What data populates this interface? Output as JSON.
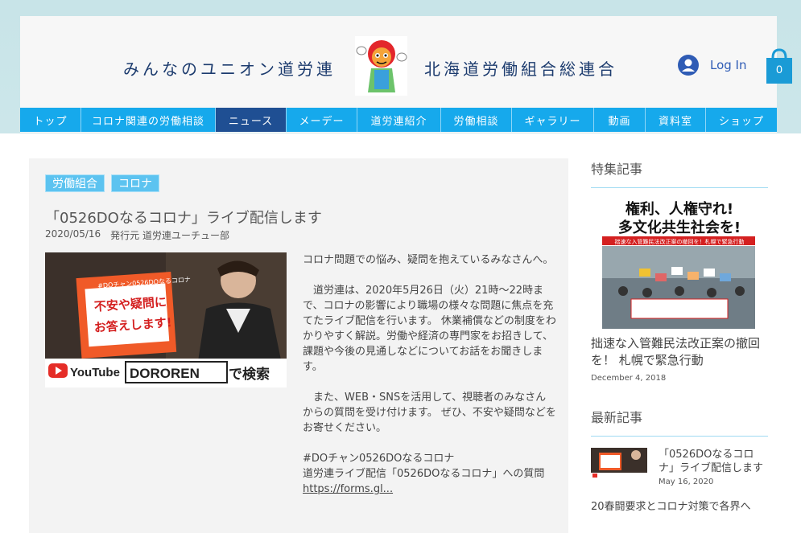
{
  "header": {
    "title_left": "みんなのユニオン道労連",
    "title_right": "北海道労働組合総連合",
    "login_label": "Log In",
    "cart_count": "0"
  },
  "nav": {
    "items": [
      {
        "label": "トップ",
        "width": 76
      },
      {
        "label": "コロナ関連の労働相談",
        "width": 167
      },
      {
        "label": "ニュース",
        "width": 88,
        "active": true
      },
      {
        "label": "メーデー",
        "width": 88
      },
      {
        "label": "道労連紹介",
        "width": 104
      },
      {
        "label": "労働相談",
        "width": 88
      },
      {
        "label": "ギャラリー",
        "width": 102
      },
      {
        "label": "動画",
        "width": 64
      },
      {
        "label": "資料室",
        "width": 75
      },
      {
        "label": "ショップ",
        "width": 88
      }
    ]
  },
  "article": {
    "tags": [
      "労働組合",
      "コロナ"
    ],
    "title": "「0526DOなるコロナ」ライブ配信します",
    "date": "2020/05/16",
    "publisher": "発行元 道労連ユーチュー部",
    "thumb": {
      "sign_top": "#DOチャン0526DOなるコロナ",
      "sign_main1": "不安や疑問に",
      "sign_main2": "お答えします!",
      "youtube": "YouTube",
      "channel": "DOROREN",
      "search": "で検索"
    },
    "paragraphs": [
      "コロナ問題での悩み、疑問を抱えているみなさんへ。",
      "　道労連は、2020年5月26日（火）21時～22時まで、コロナの影響により職場の様々な問題に焦点を充てたライブ配信を行います。 休業補償などの制度をわかりやすく解説。労働や経済の専門家をお招きして、課題や今後の見通しなどについてお話をお聞きします。",
      "　また、WEB・SNSを活用して、視聴者のみなさんからの質問を受け付けます。 ぜひ、不安や疑問などをお寄せください。"
    ],
    "hashtag": "#DOチャン0526DOなるコロナ",
    "form_label": "道労連ライブ配信「0526DOなるコロナ」への質問",
    "link": "https://forms.gl..."
  },
  "sidebar": {
    "featured_heading": "特集記事",
    "featured": {
      "img_line1": "権利、人権守れ!",
      "img_line2": "多文化共生社会を!",
      "img_sub": "拙速な入管難民法改正案の撤回を！札幌で緊急行動",
      "title": "拙速な入管難民法改正案の撤回を！ 札幌で緊急行動",
      "date": "December 4, 2018"
    },
    "recent_heading": "最新記事",
    "recent": [
      {
        "title": "「0526DOなるコロナ」ライブ配信します",
        "date": "May 16, 2020"
      }
    ],
    "next_title": "20春闘要求とコロナ対策で各界へ"
  },
  "colors": {
    "nav": "#16a9ec",
    "nav_active": "#1f4f93",
    "tag": "#5cc3f0",
    "accent_blue": "#2f5cb5"
  }
}
